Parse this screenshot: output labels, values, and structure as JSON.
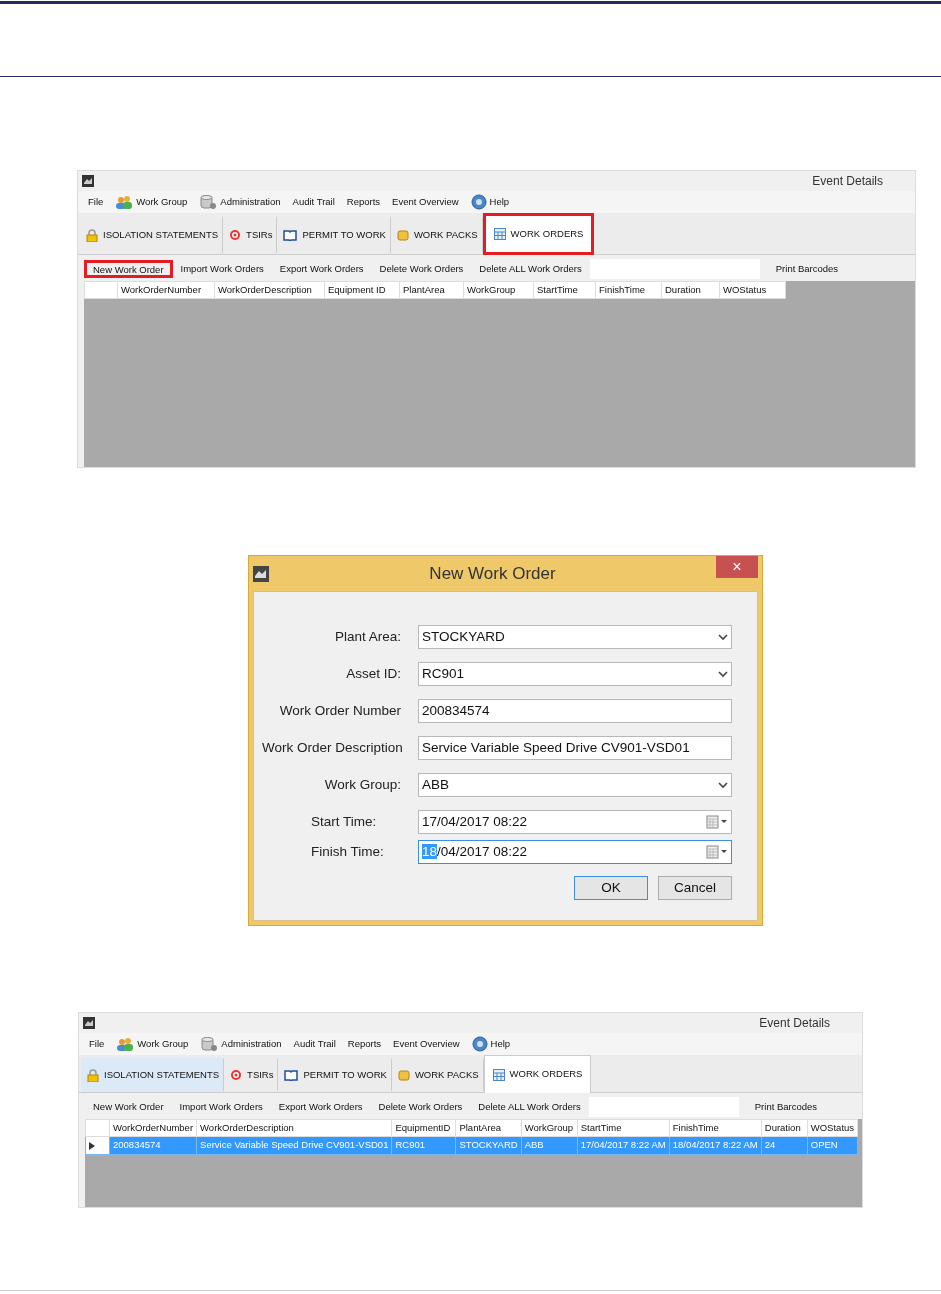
{
  "screenshots": [
    {
      "kind": "app",
      "title": "Event Details",
      "menu": [
        {
          "label": "File"
        },
        {
          "label": "Work Group"
        },
        {
          "label": "Administration"
        },
        {
          "label": "Audit Trail"
        },
        {
          "label": "Reports"
        },
        {
          "label": "Event Overview"
        },
        {
          "label": "Help"
        }
      ],
      "tabs": [
        {
          "label": "ISOLATION STATEMENTS",
          "selected": false,
          "highlighted": false
        },
        {
          "label": "TSIRs",
          "selected": false,
          "highlighted": false
        },
        {
          "label": "PERMIT TO WORK",
          "selected": false,
          "highlighted": false
        },
        {
          "label": "WORK PACKS",
          "selected": false,
          "highlighted": false
        },
        {
          "label": "WORK ORDERS",
          "selected": true,
          "highlighted": true
        }
      ],
      "toolbar": [
        {
          "label": "New Work Order",
          "highlighted": true
        },
        {
          "label": "Import Work Orders",
          "highlighted": false
        },
        {
          "label": "Export Work Orders",
          "highlighted": false
        },
        {
          "label": "Delete Work Orders",
          "highlighted": false
        },
        {
          "label": "Delete ALL Work Orders",
          "highlighted": false
        }
      ],
      "print_button": "Print Barcodes",
      "columns": [
        "WorkOrderNumber",
        "WorkOrderDescription",
        "Equipment ID",
        "PlantArea",
        "WorkGroup",
        "StartTime",
        "FinishTime",
        "Duration",
        "WOStatus"
      ]
    },
    {
      "kind": "dialog",
      "title": "New Work Order",
      "close": "×",
      "fields": [
        {
          "kind": "dropdown",
          "label": "Plant Area:",
          "value": "STOCKYARD"
        },
        {
          "kind": "dropdown",
          "label": "Asset ID:",
          "value": "RC901"
        },
        {
          "kind": "text",
          "label": "Work Order Number",
          "value": "200834574"
        },
        {
          "kind": "text",
          "label": "Work Order Description",
          "value": "Service Variable Speed Drive CV901-VSD01"
        },
        {
          "kind": "dropdown",
          "label": "Work Group:",
          "value": "ABB"
        },
        {
          "kind": "date",
          "label": "Start Time:",
          "value": "17/04/2017 08:22",
          "focused": false
        },
        {
          "kind": "date",
          "label": "Finish Time:",
          "selected_text": "18",
          "value": "/04/2017 08:22",
          "focused": true
        }
      ],
      "buttons": [
        {
          "label": "OK",
          "default": true
        },
        {
          "label": "Cancel",
          "default": false
        }
      ]
    },
    {
      "kind": "app",
      "title": "Event Details",
      "menu": [
        {
          "label": "File"
        },
        {
          "label": "Work Group"
        },
        {
          "label": "Administration"
        },
        {
          "label": "Audit Trail"
        },
        {
          "label": "Reports"
        },
        {
          "label": "Event Overview"
        },
        {
          "label": "Help"
        }
      ],
      "tabs": [
        {
          "label": "ISOLATION STATEMENTS",
          "selected": false,
          "highlighted": false
        },
        {
          "label": "TSIRs",
          "selected": false,
          "highlighted": false
        },
        {
          "label": "PERMIT TO WORK",
          "selected": false,
          "highlighted": false
        },
        {
          "label": "WORK PACKS",
          "selected": false,
          "highlighted": false
        },
        {
          "label": "WORK ORDERS",
          "selected": true,
          "highlighted": false
        }
      ],
      "toolbar": [
        {
          "label": "New Work Order",
          "highlighted": false
        },
        {
          "label": "Import Work Orders",
          "highlighted": false
        },
        {
          "label": "Export Work Orders",
          "highlighted": false
        },
        {
          "label": "Delete Work Orders",
          "highlighted": false
        },
        {
          "label": "Delete ALL Work Orders",
          "highlighted": false
        }
      ],
      "print_button": "Print Barcodes",
      "columns": [
        "WorkOrderNumber",
        "WorkOrderDescription",
        "EquipmentID",
        "PlantArea",
        "WorkGroup",
        "StartTime",
        "FinishTime",
        "Duration",
        "WOStatus"
      ],
      "rows": [
        {
          "selected": true,
          "cells": [
            "200834574",
            "Service Variable Speed Drive CV901-VSD01",
            "RC901",
            "STOCKYARD",
            "ABB",
            "17/04/2017 8:22 AM",
            "18/04/2017 8:22 AM",
            "24",
            "OPEN"
          ]
        }
      ]
    }
  ]
}
